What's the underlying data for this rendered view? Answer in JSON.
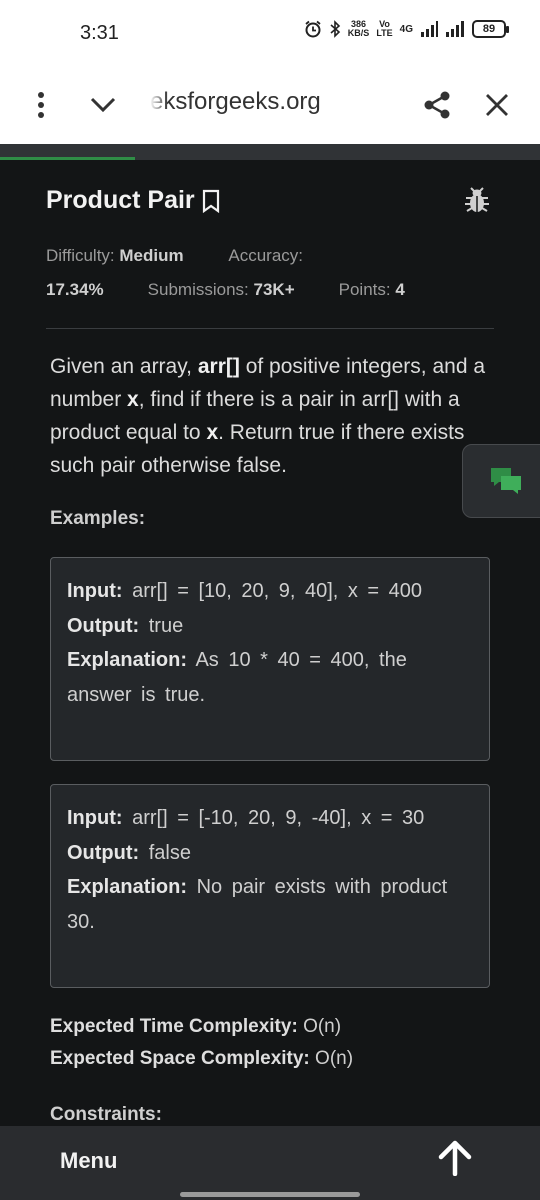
{
  "status": {
    "time": "3:31",
    "data_speed_value": "386",
    "data_speed_unit": "KB/S",
    "volte": "Vo\nLTE",
    "network": "4G",
    "battery": "89",
    "icons": [
      "alarm-icon",
      "bluetooth-icon",
      "signal-icon",
      "signal-icon",
      "battery-icon"
    ]
  },
  "browser": {
    "url_text": "eksforgeeks.org",
    "icons": [
      "more-vert-icon",
      "chevron-down-icon",
      "share-icon",
      "close-icon"
    ]
  },
  "page_load_progress": 0.25,
  "problem": {
    "title": "Product Pair",
    "difficulty_label": "Difficulty:",
    "difficulty_value": "Medium",
    "accuracy_label": "Accuracy:",
    "accuracy_value": "17.34%",
    "submissions_label": "Submissions:",
    "submissions_value": "73K+",
    "points_label": "Points:",
    "points_value": "4",
    "desc_part1": "Given an array, ",
    "desc_arr": "arr[]",
    "desc_part2": " of positive integers, and a number ",
    "desc_x1": "x",
    "desc_part3": ", find if there is a pair in arr[] with a product equal to ",
    "desc_x2": "x",
    "desc_part4": ". Return true if there exists such pair otherwise false."
  },
  "examples_heading": "Examples:",
  "examples": [
    {
      "input_label": "Input:",
      "input_value": "arr[] = [10, 20, 9, 40], x = 400",
      "output_label": "Output:",
      "output_value": "true",
      "explanation_label": "Explanation:",
      "explanation_value": "As 10 * 40 = 400, the answer is true."
    },
    {
      "input_label": "Input:",
      "input_value": "arr[] = [-10, 20, 9, -40], x = 30",
      "output_label": "Output:",
      "output_value": "false",
      "explanation_label": "Explanation:",
      "explanation_value": "No pair exists with product 30."
    }
  ],
  "complexity": {
    "time_label": "Expected Time Complexity:",
    "time_value": "O(n)",
    "space_label": "Expected Space Complexity:",
    "space_value": "O(n)"
  },
  "constraints_heading": "Constraints:",
  "bottom": {
    "menu_label": "Menu"
  },
  "colors": {
    "accent_green": "#2f8d46",
    "background": "#131516"
  }
}
